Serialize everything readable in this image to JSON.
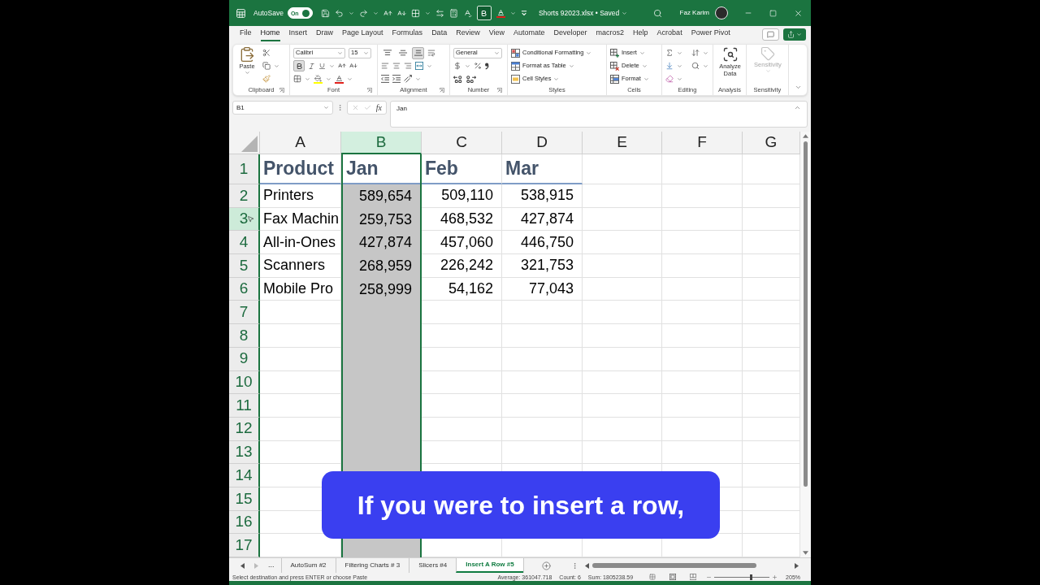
{
  "title_bar": {
    "autosave": {
      "label": "AutoSave",
      "toggle_text": "On",
      "on": true
    },
    "bold_pressed": true,
    "document_title": "Shorts 92023.xlsx • Saved",
    "user_name": "Faz Karim"
  },
  "ribbon_tabs": [
    {
      "label": "File",
      "selected": false
    },
    {
      "label": "Home",
      "selected": true
    },
    {
      "label": "Insert",
      "selected": false
    },
    {
      "label": "Draw",
      "selected": false
    },
    {
      "label": "Page Layout",
      "selected": false
    },
    {
      "label": "Formulas",
      "selected": false
    },
    {
      "label": "Data",
      "selected": false
    },
    {
      "label": "Review",
      "selected": false
    },
    {
      "label": "View",
      "selected": false
    },
    {
      "label": "Automate",
      "selected": false
    },
    {
      "label": "Developer",
      "selected": false
    },
    {
      "label": "macros2",
      "selected": false
    },
    {
      "label": "Help",
      "selected": false
    },
    {
      "label": "Acrobat",
      "selected": false
    },
    {
      "label": "Power Pivot",
      "selected": false
    }
  ],
  "ribbon": {
    "clipboard": {
      "paste": "Paste",
      "label": "Clipboard"
    },
    "font": {
      "font_name": "Calibri",
      "font_size": "15",
      "bold_pressed": true,
      "label": "Font"
    },
    "alignment": {
      "vertical_align": [
        {
          "selected": false
        },
        {
          "selected": false
        },
        {
          "selected": true
        }
      ],
      "label": "Alignment"
    },
    "number": {
      "format": "General",
      "label": "Number"
    },
    "styles": {
      "buttons": [
        "Conditional Formatting",
        "Format as Table",
        "Cell Styles"
      ],
      "label": "Styles"
    },
    "cells": {
      "buttons": [
        "Insert",
        "Delete",
        "Format"
      ],
      "label": "Cells"
    },
    "editing": {
      "label": "Editing"
    },
    "analysis": {
      "button": "Analyze Data",
      "label": "Analysis"
    },
    "sensitivity": {
      "button": "Sensitivity",
      "disabled": true,
      "label": "Sensitivity"
    }
  },
  "formula_bar": {
    "name_box": "B1",
    "function_label": "fx",
    "value": "Jan"
  },
  "sheet": {
    "columns": [
      {
        "label": "A",
        "selected": false
      },
      {
        "label": "B",
        "selected": true
      },
      {
        "label": "C",
        "selected": false
      },
      {
        "label": "D",
        "selected": false
      },
      {
        "label": "E",
        "selected": false
      },
      {
        "label": "F",
        "selected": false
      },
      {
        "label": "G",
        "selected": false
      }
    ],
    "rows": [
      {
        "number": "1",
        "kind": "header",
        "highlighted": true,
        "hovered": false,
        "active": true,
        "cells": [
          "Product",
          "Jan",
          "Feb",
          "Mar"
        ]
      },
      {
        "number": "2",
        "kind": "data",
        "highlighted": true,
        "hovered": false,
        "active": false,
        "cells": [
          "Printers",
          "589,654",
          "509,110",
          "538,915"
        ]
      },
      {
        "number": "3",
        "kind": "data",
        "highlighted": true,
        "hovered": true,
        "active": false,
        "cells": [
          "Fax Machin",
          "259,753",
          "468,532",
          "427,874"
        ]
      },
      {
        "number": "4",
        "kind": "data",
        "highlighted": true,
        "hovered": false,
        "active": false,
        "cells": [
          "All-in-Ones",
          "427,874",
          "457,060",
          "446,750"
        ]
      },
      {
        "number": "5",
        "kind": "data",
        "highlighted": true,
        "hovered": false,
        "active": false,
        "cells": [
          "Scanners",
          "268,959",
          "226,242",
          "321,753"
        ]
      },
      {
        "number": "6",
        "kind": "data",
        "highlighted": true,
        "hovered": false,
        "active": false,
        "cells": [
          "Mobile Pro",
          "258,999",
          "54,162",
          "77,043"
        ]
      },
      {
        "number": "7",
        "kind": "data",
        "highlighted": true,
        "hovered": false,
        "active": false
      },
      {
        "number": "8",
        "kind": "data",
        "highlighted": true,
        "hovered": false,
        "active": false
      },
      {
        "number": "9",
        "kind": "data",
        "highlighted": true,
        "hovered": false,
        "active": false
      },
      {
        "number": "10",
        "kind": "data",
        "highlighted": true,
        "hovered": false,
        "active": false
      },
      {
        "number": "11",
        "kind": "data",
        "highlighted": true,
        "hovered": false,
        "active": false
      },
      {
        "number": "12",
        "kind": "data",
        "highlighted": true,
        "hovered": false,
        "active": false
      },
      {
        "number": "13",
        "kind": "data",
        "highlighted": true,
        "hovered": false,
        "active": false
      },
      {
        "number": "14",
        "kind": "data",
        "highlighted": true,
        "hovered": false,
        "active": false
      },
      {
        "number": "15",
        "kind": "data",
        "highlighted": true,
        "hovered": false,
        "active": false
      },
      {
        "number": "16",
        "kind": "data",
        "highlighted": true,
        "hovered": false,
        "active": false
      },
      {
        "number": "17",
        "kind": "data",
        "highlighted": true,
        "hovered": false,
        "active": false
      }
    ]
  },
  "caption": "If you were to insert a row,",
  "sheet_tabs": {
    "overflow": "...",
    "tabs": [
      {
        "label": "AutoSum #2",
        "selected": false
      },
      {
        "label": "Filtering Charts # 3",
        "selected": false
      },
      {
        "label": "Slicers #4",
        "selected": false
      },
      {
        "label": "Insert A Row #5",
        "selected": true
      }
    ]
  },
  "status_bar": {
    "message": "Select destination and press ENTER or choose Paste",
    "average": "Average: 361047.718",
    "count": "Count: 6",
    "sum": "Sum: 1805238.59",
    "zoom": {
      "level": 0.67,
      "reading": "205%"
    }
  }
}
